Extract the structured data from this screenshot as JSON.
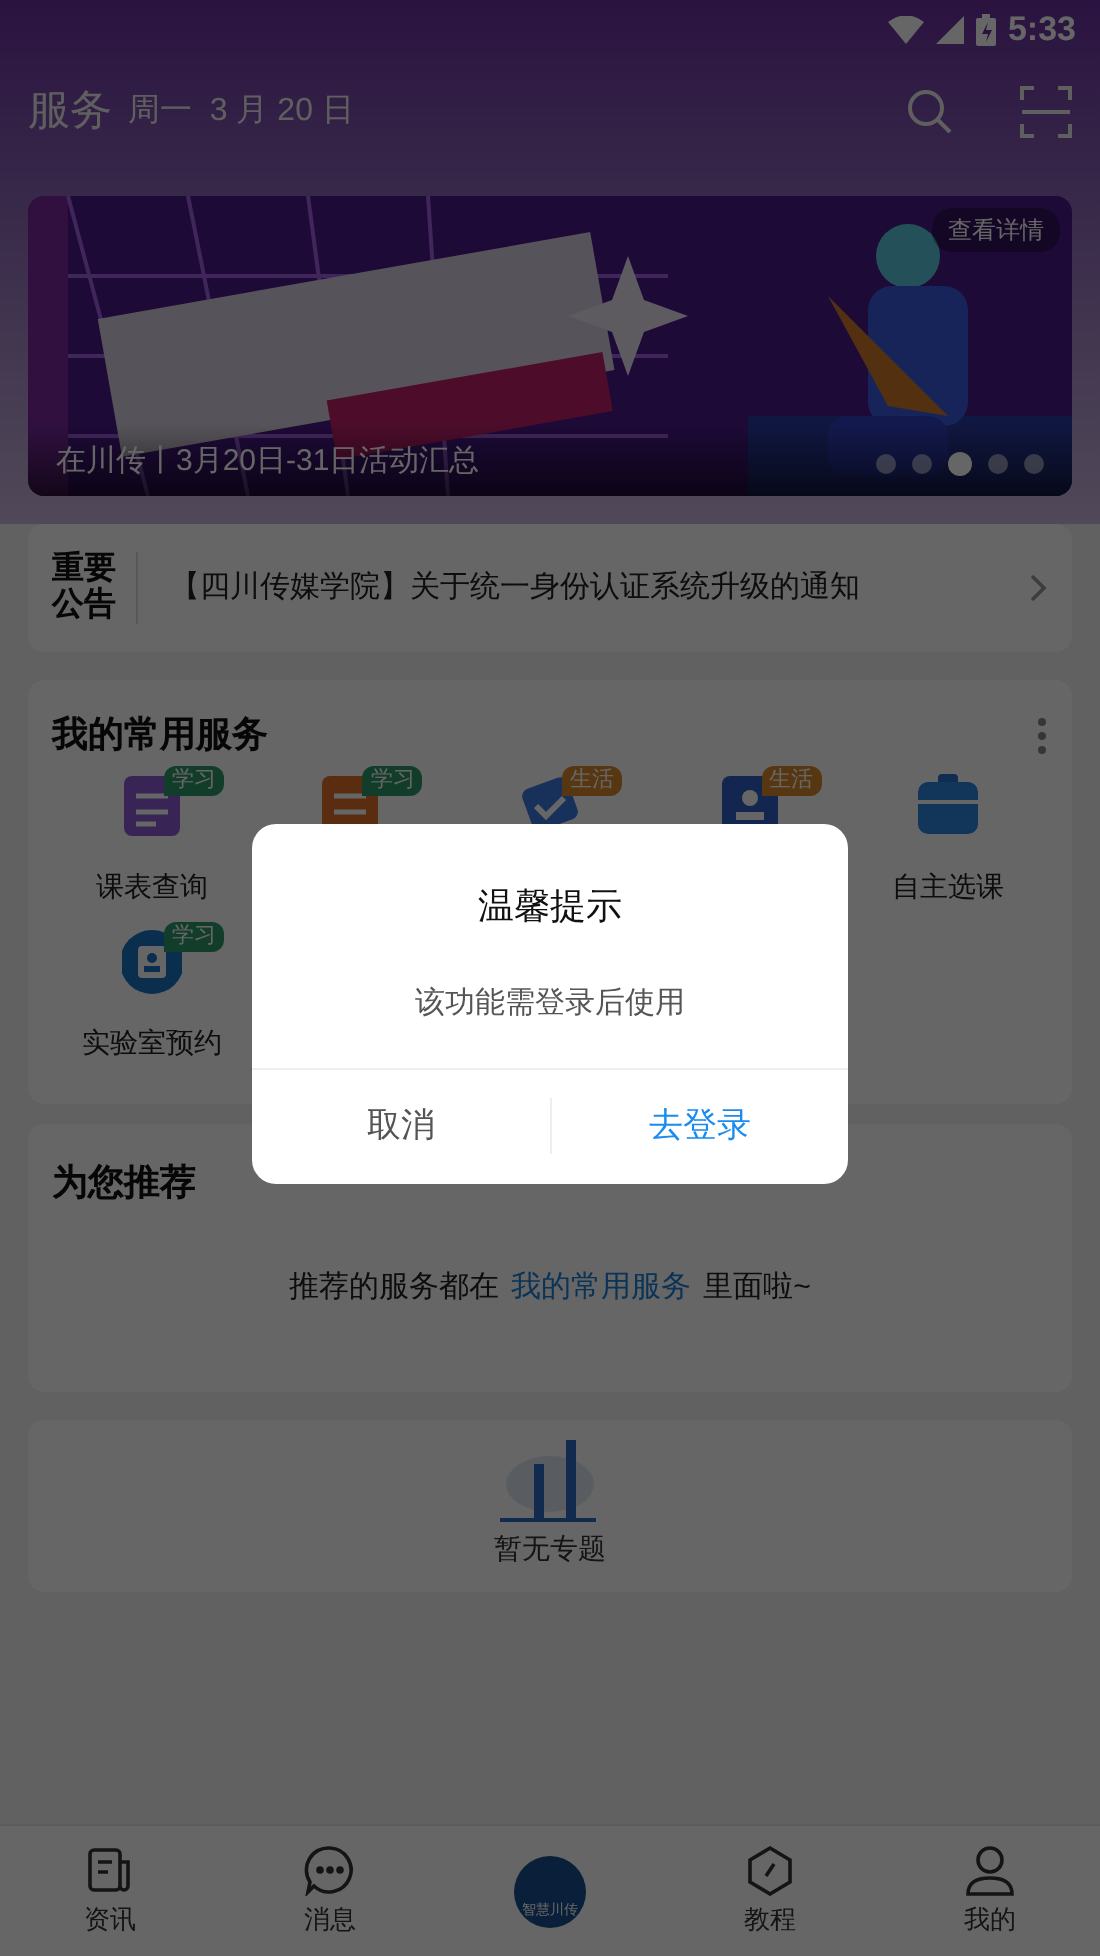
{
  "status_bar": {
    "time": "5:33"
  },
  "header": {
    "title": "服务",
    "date": "周一  3 月 20 日"
  },
  "banner": {
    "caption": "在川传丨3月20日-31日活动汇总",
    "detail_button": "查看详情",
    "dots": [
      {
        "selected": false
      },
      {
        "selected": false
      },
      {
        "selected": true
      },
      {
        "selected": false
      },
      {
        "selected": false
      }
    ]
  },
  "notice": {
    "label": "重要公告",
    "text": "【四川传媒学院】关于统一身份认证系统升级的通知"
  },
  "services": {
    "title": "我的常用服务",
    "items": [
      {
        "label": "课表查询",
        "tag": "学习",
        "kind": "study"
      },
      {
        "tag": "学习",
        "kind": "study"
      },
      {
        "tag": "生活",
        "kind": "life"
      },
      {
        "tag": "生活",
        "kind": "life"
      },
      {
        "label": "自主选课"
      },
      {
        "label": "实验室预约",
        "tag": "学习",
        "kind": "study"
      }
    ]
  },
  "recommend": {
    "title": "为您推荐",
    "text_before": "推荐的服务都在",
    "link": "我的常用服务",
    "text_after": "里面啦~"
  },
  "topics": {
    "empty_text": "暂无专题"
  },
  "dialog": {
    "title": "温馨提示",
    "message": "该功能需登录后使用",
    "cancel": "取消",
    "confirm": "去登录"
  },
  "tab_bar": [
    {
      "label": "资讯",
      "kind": "tab"
    },
    {
      "label": "消息",
      "kind": "tab"
    },
    {
      "label": "智慧川传",
      "kind": "logo"
    },
    {
      "label": "教程",
      "kind": "tab"
    },
    {
      "label": "我的",
      "kind": "tab"
    }
  ]
}
